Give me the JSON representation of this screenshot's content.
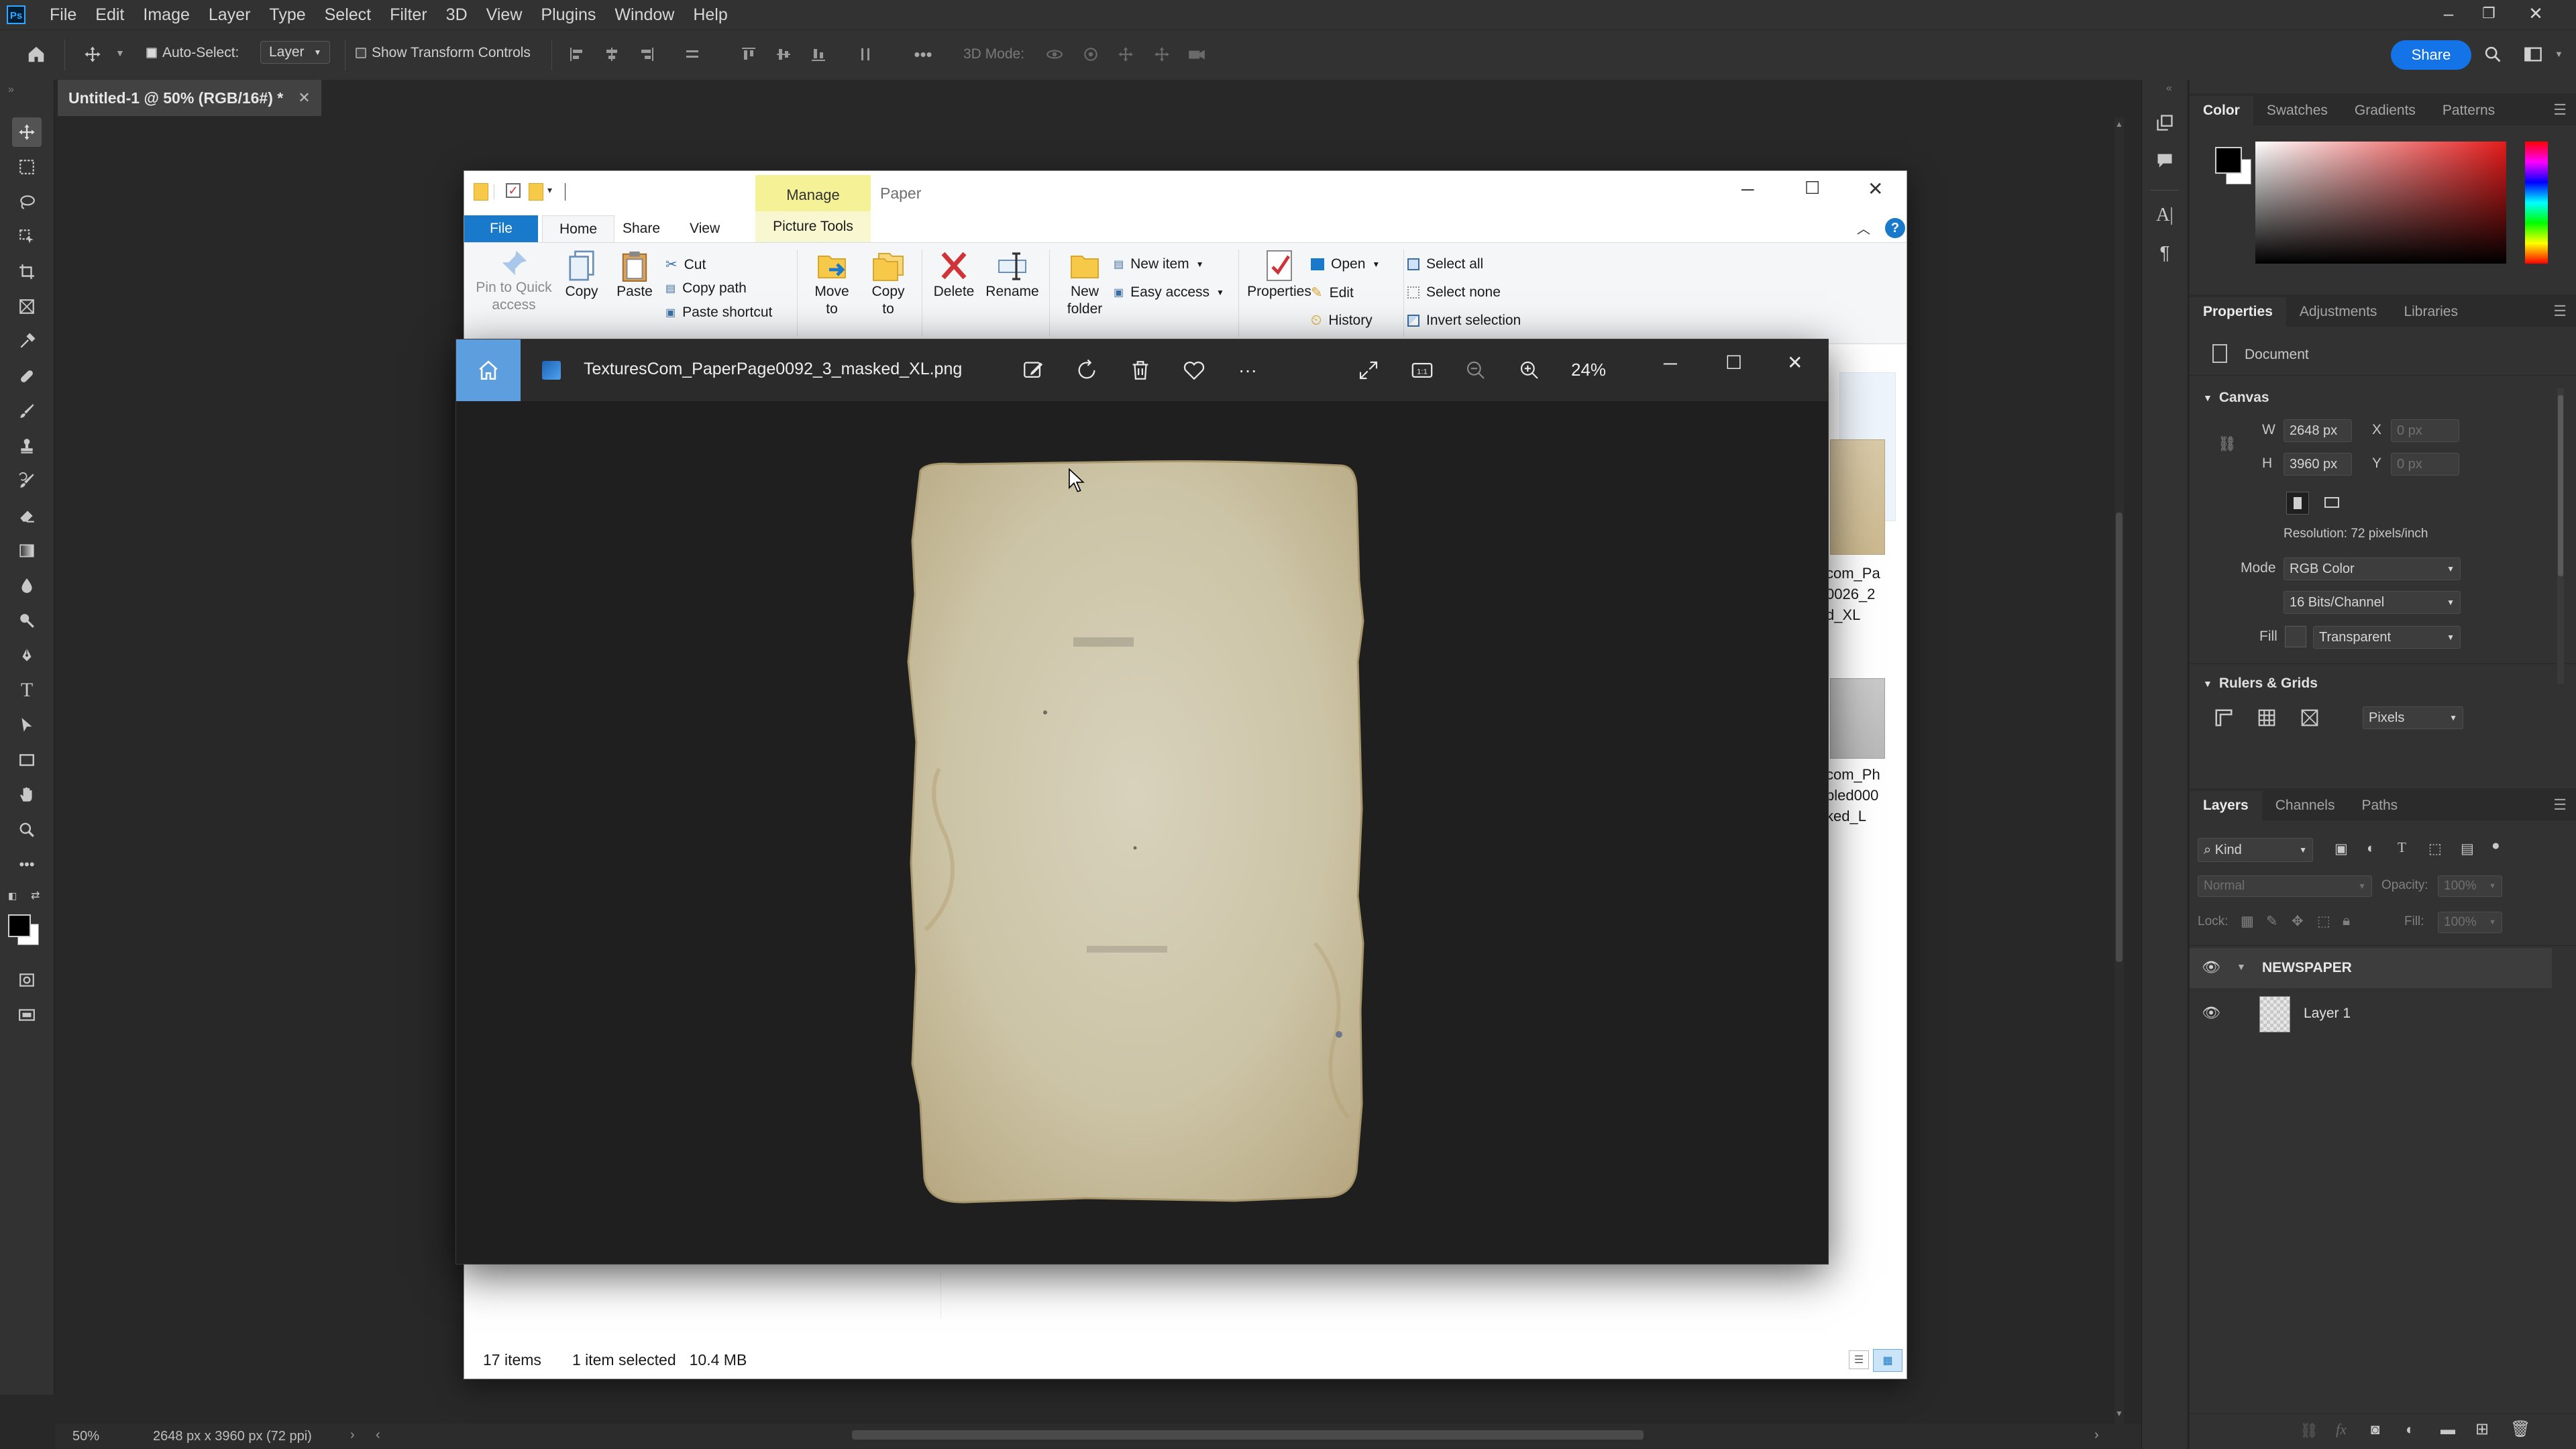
{
  "photoshop": {
    "menu": [
      "File",
      "Edit",
      "Image",
      "Layer",
      "Type",
      "Select",
      "Filter",
      "3D",
      "View",
      "Plugins",
      "Window",
      "Help"
    ],
    "options": {
      "auto_select_label": "Auto-Select:",
      "auto_select_target": "Layer",
      "show_transform_label": "Show Transform Controls",
      "mode_3d_label": "3D Mode:",
      "share_label": "Share"
    },
    "document_tab": "Untitled-1 @ 50% (RGB/16#) *",
    "status": {
      "zoom": "50%",
      "doc_size": "2648 px x 3960 px (72 ppi)"
    },
    "panels": {
      "color_tabs": [
        "Color",
        "Swatches",
        "Gradients",
        "Patterns"
      ],
      "properties_tabs": [
        "Properties",
        "Adjustments",
        "Libraries"
      ],
      "document_label": "Document",
      "canvas_header": "Canvas",
      "width_label": "W",
      "width_value": "2648 px",
      "height_label": "H",
      "height_value": "3960 px",
      "x_label": "X",
      "x_value": "0 px",
      "y_label": "Y",
      "y_value": "0 px",
      "resolution": "Resolution: 72 pixels/inch",
      "mode_label": "Mode",
      "mode_value": "RGB Color",
      "bit_depth": "16 Bits/Channel",
      "fill_label": "Fill",
      "fill_value": "Transparent",
      "rulers_header": "Rulers & Grids",
      "units": "Pixels",
      "layers_tabs": [
        "Layers",
        "Channels",
        "Paths"
      ],
      "kind_label": "Kind",
      "blend_mode": "Normal",
      "opacity_label": "Opacity:",
      "opacity_value": "100%",
      "lock_label": "Lock:",
      "fill_pct_label": "Fill:",
      "fill_pct_value": "100%",
      "layers": [
        {
          "name": "NEWSPAPER",
          "type": "group"
        },
        {
          "name": "Layer 1",
          "type": "layer"
        }
      ]
    },
    "colors": {
      "accent": "#1473e6",
      "bg": "#282828",
      "panel": "#323232"
    }
  },
  "explorer": {
    "title": "Paper",
    "manage_tab": "Manage",
    "tabs": [
      "File",
      "Home",
      "Share",
      "View",
      "Picture Tools"
    ],
    "ribbon": {
      "pin": "Pin to Quick access",
      "copy": "Copy",
      "paste": "Paste",
      "cut": "Cut",
      "copy_path": "Copy path",
      "paste_shortcut": "Paste shortcut",
      "move_to": "Move to",
      "copy_to": "Copy to",
      "delete": "Delete",
      "rename": "Rename",
      "new_folder": "New folder",
      "new_item": "New item",
      "easy_access": "Easy access",
      "properties": "Properties",
      "open": "Open",
      "edit": "Edit",
      "history": "History",
      "select_all": "Select all",
      "select_none": "Select none",
      "invert_selection": "Invert selection"
    },
    "files_partial": [
      "com_Pa",
      "0026_2",
      "d_XL",
      "com_Ph",
      "bled000",
      "ked_L"
    ],
    "status": {
      "items": "17 items",
      "selected": "1 item selected",
      "size": "10.4 MB"
    },
    "colors": {
      "file_tab": "#1979ca",
      "manage": "#f4f196"
    }
  },
  "photos": {
    "filename": "TexturesCom_PaperPage0092_3_masked_XL.png",
    "zoom": "24%",
    "icons": [
      "home-icon",
      "edit-image-icon",
      "rotate-icon",
      "delete-icon",
      "favorite-icon",
      "more-icon",
      "full-screen-icon",
      "actual-size-icon",
      "zoom-out-icon",
      "zoom-in-icon"
    ]
  }
}
